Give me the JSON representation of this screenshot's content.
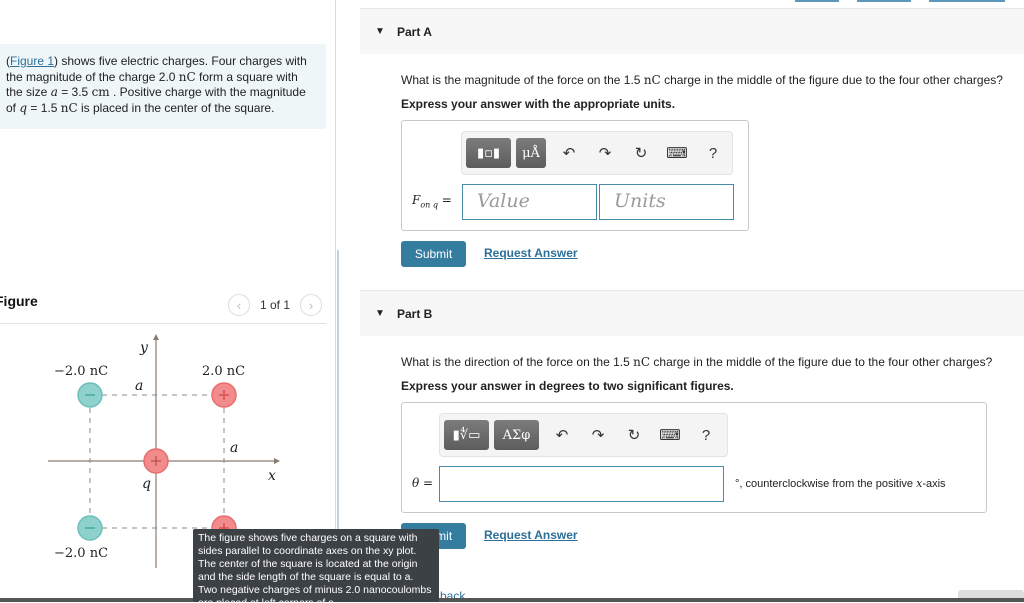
{
  "problem": {
    "figure_link": "Figure 1",
    "intro_line1_suffix": ") shows five electric charges. Four charges with",
    "intro_line2_prefix": "the magnitude of the charge 2.0 ",
    "intro_unit_nC": "nC",
    "intro_line2_suffix": " form a square with",
    "intro_line3_prefix": "the size ",
    "intro_var_a": "a",
    "intro_line3_mid": " = 3.5 ",
    "intro_unit_cm": "cm",
    "intro_line3_suffix": " . Positive charge with the magnitude",
    "intro_line4_prefix": "of ",
    "intro_var_q": "q",
    "intro_line4_mid": " = 1.5 ",
    "intro_line4_suffix": " is placed in the center of the square."
  },
  "figure": {
    "title": "Figure",
    "pager_text": "1 of 1",
    "prev_icon": "‹",
    "next_icon": "›",
    "labels": {
      "top_left": "−2.0 nC",
      "top_right": "2.0 nC",
      "bottom_left": "−2.0 nC",
      "y_axis": "y",
      "x_axis": "x",
      "side_top": "a",
      "side_right": "a",
      "center": "q"
    },
    "charges": [
      {
        "position": "top-left",
        "sign": "−",
        "color": "#8fd1cc"
      },
      {
        "position": "top-right",
        "sign": "+",
        "color": "#f28b8b"
      },
      {
        "position": "center",
        "sign": "+",
        "color": "#f28b8b"
      },
      {
        "position": "bottom-left",
        "sign": "−",
        "color": "#8fd1cc"
      },
      {
        "position": "bottom-right",
        "sign": "+",
        "color": "#f28b8b"
      }
    ],
    "tooltip": "The figure shows five charges on a square with sides parallel to coordinate axes on the xy plot. The center of the square is located at the origin and the side length of the square is equal to a. Two negative charges of minus 2.0 nanocoulombs are placed at left corners of a"
  },
  "partA": {
    "title": "Part A",
    "question_prefix": "What is the magnitude of the force on the 1.5 ",
    "question_unit": "nC",
    "question_suffix": " charge in the middle of the figure due to the four other charges?",
    "instruction": "Express your answer with the appropriate units.",
    "toolbar": {
      "templates_icon": "▮▫▮",
      "units_label": "μÅ",
      "undo_icon": "↶",
      "redo_icon": "↷",
      "reset_icon": "↻",
      "keyboard_icon": "⌨",
      "help_label": "?"
    },
    "label_main": "F",
    "label_sub": "on q",
    "label_eq": "=",
    "value_placeholder": "Value",
    "units_placeholder": "Units",
    "submit_label": "Submit",
    "request_label": "Request Answer"
  },
  "partB": {
    "title": "Part B",
    "question_prefix": "What is the direction of the force on the 1.5 ",
    "question_unit": "nC",
    "question_suffix": " charge in the middle of the figure due to the four other charges?",
    "instruction": "Express your answer in degrees to two significant figures.",
    "toolbar": {
      "templates_icon": "▮∜▭",
      "symbols_label": "ΑΣφ",
      "undo_icon": "↶",
      "redo_icon": "↷",
      "reset_icon": "↻",
      "keyboard_icon": "⌨",
      "help_label": "?"
    },
    "label": "θ =",
    "value": "",
    "unit_suffix_prefix": "°, counterclockwise from the positive ",
    "unit_suffix_var": "x",
    "unit_suffix_end": "-axis",
    "submit_label": "Submit",
    "request_label": "Request Answer"
  },
  "footer": {
    "back_link": "back"
  }
}
